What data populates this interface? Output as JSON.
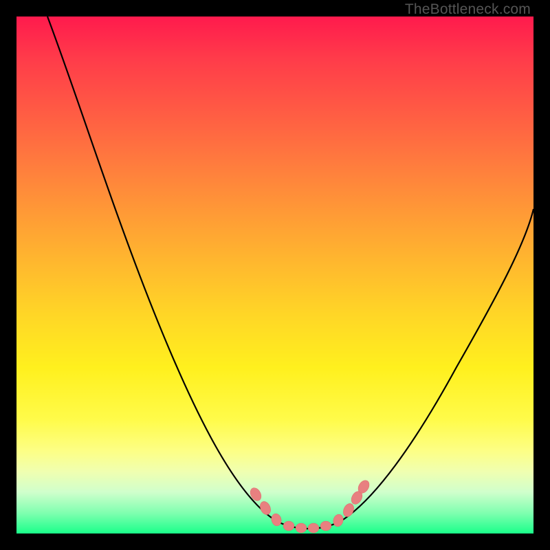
{
  "watermark": "TheBottleneck.com",
  "chart_data": {
    "type": "line",
    "title": "",
    "xlabel": "",
    "ylabel": "",
    "xlim": [
      0,
      100
    ],
    "ylim": [
      0,
      100
    ],
    "grid": false,
    "legend": false,
    "series": [
      {
        "name": "bottleneck-curve",
        "color": "#000000",
        "x": [
          6,
          10,
          14,
          18,
          22,
          26,
          30,
          34,
          38,
          42,
          46,
          50,
          52,
          54,
          56,
          58,
          60,
          62,
          66,
          70,
          74,
          78,
          82,
          86,
          90,
          94,
          98,
          100
        ],
        "values": [
          100,
          92,
          84,
          76,
          68,
          60,
          52,
          44,
          36,
          28,
          20,
          12,
          8,
          5,
          3,
          2,
          2,
          3,
          6,
          11,
          17,
          24,
          31,
          38,
          45,
          52,
          59,
          63
        ]
      }
    ],
    "markers": {
      "name": "emphasis-points",
      "color": "#e88080",
      "x": [
        47,
        49,
        51,
        53,
        55,
        57,
        59,
        61,
        63,
        65,
        67
      ],
      "values": [
        12,
        8,
        5,
        3,
        2,
        2,
        2,
        3,
        5,
        8,
        12
      ]
    },
    "background_gradient": {
      "top": "#ff1a4d",
      "mid": "#ffe028",
      "bottom": "#1aff8a"
    }
  }
}
